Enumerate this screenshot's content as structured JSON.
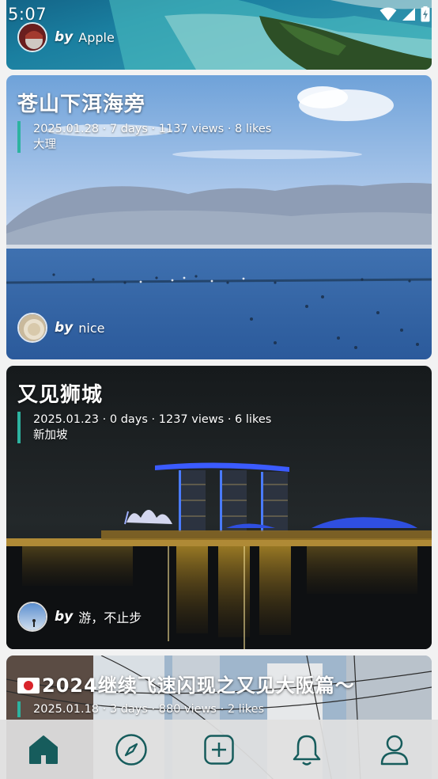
{
  "status_bar": {
    "time": "5:07"
  },
  "cards": [
    {
      "author_by": "by",
      "author_name": "Apple"
    },
    {
      "title": "苍山下洱海旁",
      "date": "2025.01.28",
      "days": "7 days",
      "views": "1137 views",
      "likes": "8 likes",
      "location": "大理",
      "author_by": "by",
      "author_name": "nice"
    },
    {
      "title": "又见狮城",
      "date": "2025.01.23",
      "days": "0 days",
      "views": "1237 views",
      "likes": "6 likes",
      "location": "新加坡",
      "author_by": "by",
      "author_name": "游，不止步"
    },
    {
      "title": "2024继续飞速闪现之又见大阪篇～",
      "date": "2025.01.18",
      "days": "3 days",
      "views": "880 views",
      "likes": "2 likes"
    }
  ],
  "bottom_nav": [
    {
      "icon": "home-icon",
      "active": true
    },
    {
      "icon": "compass-icon",
      "active": false
    },
    {
      "icon": "add-icon",
      "active": false
    },
    {
      "icon": "bell-icon",
      "active": false
    },
    {
      "icon": "profile-icon",
      "active": false
    }
  ],
  "colors": {
    "accent": "#2db3a0",
    "nav_icon": "#165c5c",
    "nav_bg": "#e0e0e0"
  }
}
